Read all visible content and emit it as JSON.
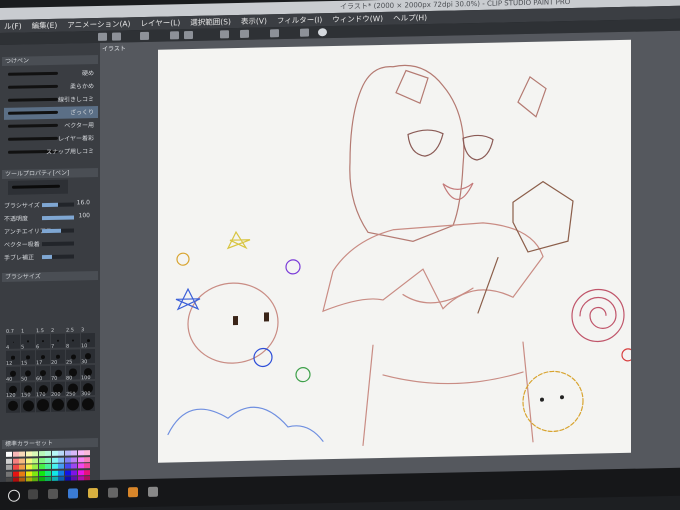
{
  "window": {
    "title": "イラスト* (2000 × 2000px 72dpi 30.0%) - CLIP STUDIO PAINT PRO"
  },
  "menu": [
    "ル(F)",
    "編集(E)",
    "アニメーション(A)",
    "レイヤー(L)",
    "選択範囲(S)",
    "表示(V)",
    "フィルター(I)",
    "ウィンドウ(W)",
    "ヘルプ(H)"
  ],
  "brush_panel": {
    "title": "つけペン",
    "items": [
      "硬め",
      "柔らかめ",
      "線引きしコミ",
      "ざっくり",
      "ベクター用",
      "レイヤー着彩",
      "スナップ用しコミ"
    ],
    "selected_index": 3
  },
  "tool_property": {
    "title": "ツールプロパティ[ペン]",
    "rows": [
      {
        "label": "ブラシサイズ",
        "value": "16.0",
        "level": 0.5
      },
      {
        "label": "不透明度",
        "value": "100",
        "level": 1.0
      },
      {
        "label": "アンチエイリアス",
        "value": "",
        "level": 0.6
      },
      {
        "label": "ベクター吸着",
        "value": "",
        "level": 0.0
      },
      {
        "label": "手ブレ補正",
        "value": "",
        "level": 0.3
      }
    ]
  },
  "brush_size": {
    "title": "ブラシサイズ",
    "numbers": [
      "0.7",
      "1",
      "1.5",
      "2",
      "2.5",
      "3",
      "4",
      "5",
      "6",
      "7",
      "8",
      "10",
      "12",
      "15",
      "17",
      "20",
      "25",
      "30",
      "40",
      "50",
      "60",
      "70",
      "80",
      "100",
      "120",
      "150",
      "170",
      "200",
      "250",
      "300"
    ]
  },
  "color_set": {
    "title": "標準カラーセット"
  },
  "canvas": {
    "tab": "イラスト"
  }
}
